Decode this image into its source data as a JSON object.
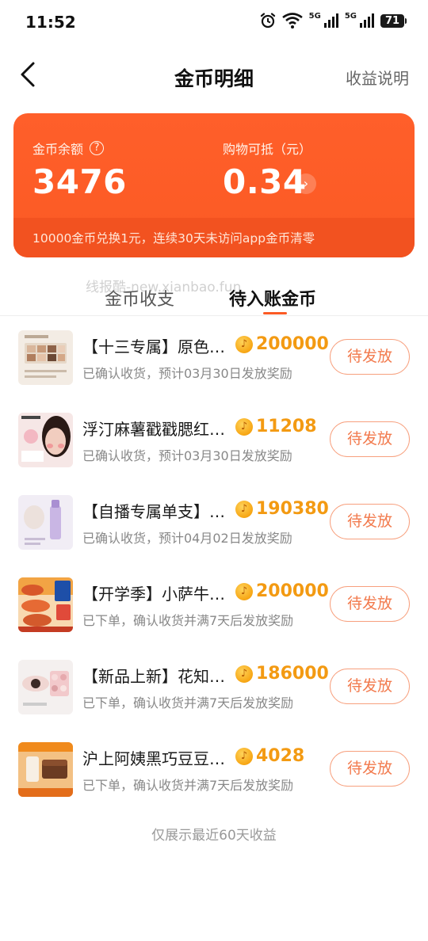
{
  "status_bar": {
    "time": "11:52",
    "network_1": "5G",
    "network_2": "5G",
    "battery": "71"
  },
  "header": {
    "title": "金币明细",
    "right_link": "收益说明"
  },
  "balance_card": {
    "coin_balance_label": "金币余额",
    "coin_balance_value": "3476",
    "deductible_label": "购物可抵（元）",
    "deductible_value": "0.34",
    "note": "10000金币兑换1元，连续30天未访问app金币清零",
    "colors": {
      "card_bg": "#fb5a24",
      "card_note_bg": "#f25220"
    }
  },
  "watermark": "线报酷-new.xianbao.fun",
  "tabs": [
    {
      "label": "金币收支",
      "active": false
    },
    {
      "label": "待入账金币",
      "active": true
    }
  ],
  "items": [
    {
      "title": "【十三专属】原色…",
      "coins": "200000",
      "subtitle": "已确认收货，预计03月30日发放奖励",
      "button": "待发放",
      "thumb": "eyeshadow-palette-image"
    },
    {
      "title": "浮汀麻薯戳戳腮红…",
      "coins": "11208",
      "subtitle": "已确认收货，预计03月30日发放奖励",
      "button": "待发放",
      "thumb": "blush-model-image"
    },
    {
      "title": "【自播专属单支】…",
      "coins": "190380",
      "subtitle": "已确认收货，预计04月02日发放奖励",
      "button": "待发放",
      "thumb": "foundation-bottle-image"
    },
    {
      "title": "【开学季】小萨牛…",
      "coins": "200000",
      "subtitle": "已下单，确认收货并满7天后发放奖励",
      "button": "待发放",
      "thumb": "pizza-product-image"
    },
    {
      "title": "【新品上新】花知…",
      "coins": "186000",
      "subtitle": "已下单，确认收货并满7天后发放奖励",
      "button": "待发放",
      "thumb": "eye-makeup-palette-image"
    },
    {
      "title": "沪上阿姨黑巧豆豆…",
      "coins": "4028",
      "subtitle": "已下单，确认收货并满7天后发放奖励",
      "button": "待发放",
      "thumb": "chocolate-drink-image"
    }
  ],
  "coin_icon_glyph": "♪",
  "footer_note": "仅展示最近60天收益",
  "accent_color": "#fb5a24",
  "coin_color": "#f39a12"
}
